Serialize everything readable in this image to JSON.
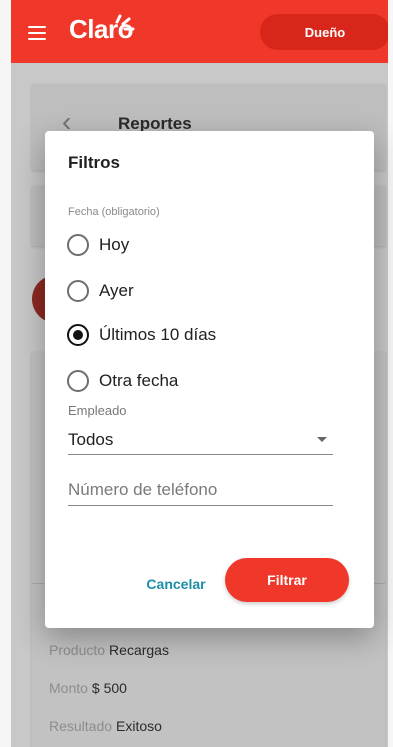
{
  "appbar": {
    "brand": "Claro",
    "role_button": "Dueño"
  },
  "background": {
    "title": "Reportes",
    "rows": [
      {
        "label": "Producto",
        "value": "Recargas"
      },
      {
        "label": "Monto",
        "value": "$ 500"
      },
      {
        "label": "Resultado",
        "value": "Exitoso"
      }
    ]
  },
  "dialog": {
    "title": "Filtros",
    "date_caption": "Fecha (obligatorio)",
    "date_options": [
      {
        "label": "Hoy",
        "checked": false
      },
      {
        "label": "Ayer",
        "checked": false
      },
      {
        "label": "Últimos 10 días",
        "checked": true
      },
      {
        "label": "Otra fecha",
        "checked": false
      }
    ],
    "employee_caption": "Empleado",
    "employee_value": "Todos",
    "phone_placeholder": "Número de teléfono",
    "cancel": "Cancelar",
    "submit": "Filtrar"
  },
  "colors": {
    "brand_red": "#ef3829",
    "link_teal": "#1d8fa6"
  }
}
